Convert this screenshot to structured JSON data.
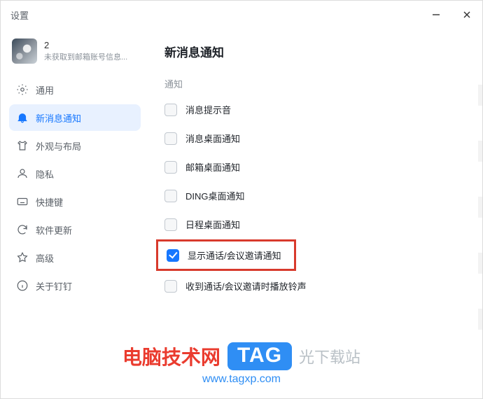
{
  "window": {
    "title": "设置"
  },
  "account": {
    "name": "2",
    "subtitle": "未获取到邮箱账号信息..."
  },
  "sidebar": {
    "items": [
      {
        "label": "通用"
      },
      {
        "label": "新消息通知"
      },
      {
        "label": "外观与布局"
      },
      {
        "label": "隐私"
      },
      {
        "label": "快捷键"
      },
      {
        "label": "软件更新"
      },
      {
        "label": "高级"
      },
      {
        "label": "关于钉钉"
      }
    ],
    "active_index": 1
  },
  "page": {
    "title": "新消息通知",
    "section": "通知",
    "options": [
      {
        "label": "消息提示音",
        "checked": false
      },
      {
        "label": "消息桌面通知",
        "checked": false
      },
      {
        "label": "邮箱桌面通知",
        "checked": false
      },
      {
        "label": "DING桌面通知",
        "checked": false
      },
      {
        "label": "日程桌面通知",
        "checked": false
      },
      {
        "label": "显示通话/会议邀请通知",
        "checked": true,
        "highlight": true
      },
      {
        "label": "收到通话/会议邀请时播放铃声",
        "checked": false
      }
    ]
  },
  "watermark": {
    "text_main": "电脑技术网",
    "tag": "TAG",
    "tail": "光下载站",
    "url": "www.tagxp.com"
  }
}
